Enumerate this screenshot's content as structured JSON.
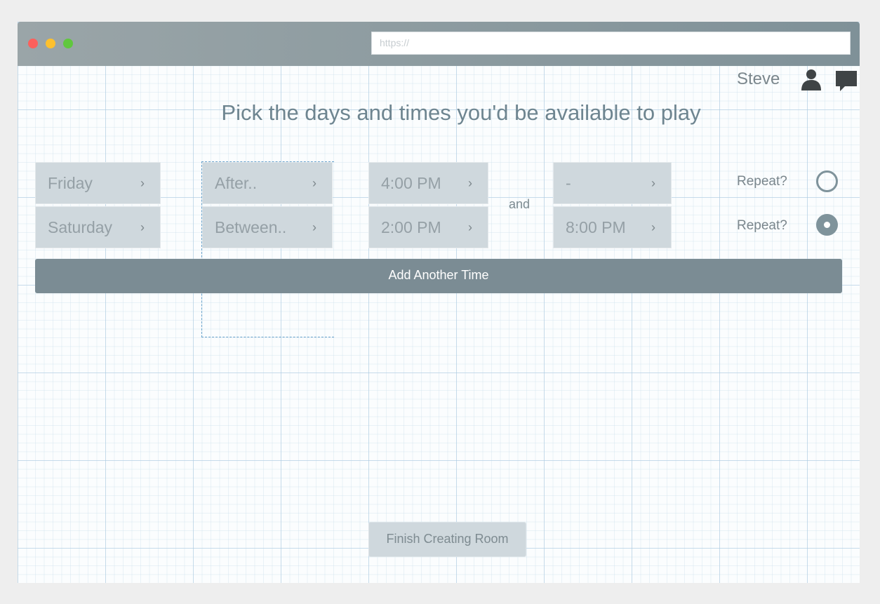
{
  "browser": {
    "url_placeholder": "https://"
  },
  "header": {
    "username": "Steve",
    "icons": [
      "user-icon",
      "chat-icon"
    ]
  },
  "main": {
    "title": "Pick the days and times you'd be available to play",
    "rows": [
      {
        "day": "Friday",
        "mode": "After..",
        "start": "4:00 PM",
        "end": "-",
        "repeat_label": "Repeat?",
        "repeat": false
      },
      {
        "day": "Saturday",
        "mode": "Between..",
        "start": "2:00 PM",
        "end": "8:00 PM",
        "repeat_label": "Repeat?",
        "repeat": true
      }
    ],
    "and_label": "and",
    "add_button": "Add Another Time",
    "finish_button": "Finish Creating Room"
  },
  "colors": {
    "accent": "#7b8c94",
    "select_bg": "#cfd8dd",
    "title_text": "#6e8590"
  }
}
